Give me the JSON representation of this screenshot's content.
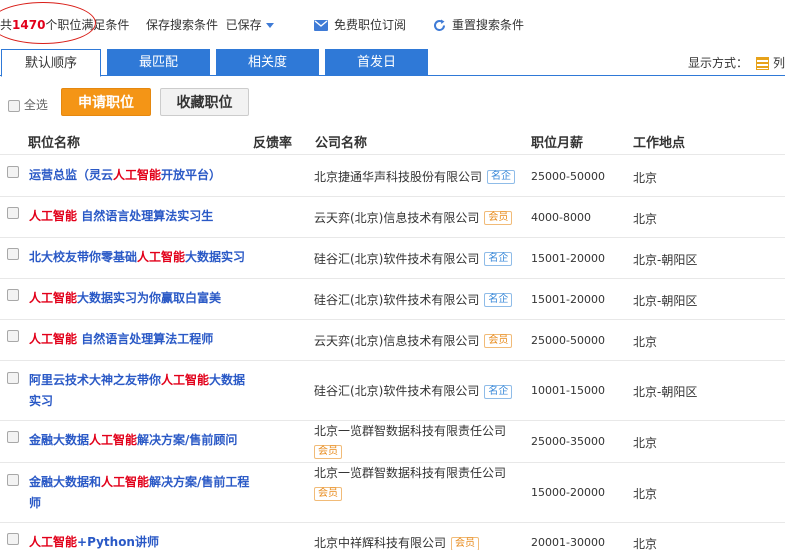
{
  "header": {
    "count_prefix": "共",
    "count": "1470",
    "count_suffix": "个职位满足条件",
    "save_search": "保存搜索条件",
    "saved": "已保存",
    "subscribe": "免费职位订阅",
    "reset": "重置搜索条件"
  },
  "tabs": [
    "默认顺序",
    "最匹配",
    "相关度",
    "首发日"
  ],
  "display_mode_label": "显示方式：",
  "display_mode_value": "列",
  "actions": {
    "select_all": "全选",
    "apply": "申请职位",
    "favorite": "收藏职位"
  },
  "columns": {
    "title": "职位名称",
    "feedback": "反馈率",
    "company": "公司名称",
    "salary": "职位月薪",
    "location": "工作地点"
  },
  "jobs": [
    {
      "p1": "运营总监（灵云",
      "kw": "人工智能",
      "p2": "开放平台）",
      "company": "北京捷通华声科技股份有限公司",
      "badge": "名企",
      "salary": "25000-50000",
      "location": "北京"
    },
    {
      "p1": "",
      "kw": "人工智能",
      "p2": " 自然语言处理算法实习生",
      "company": "云天弈(北京)信息技术有限公司",
      "badge": "会员",
      "salary": "4000-8000",
      "location": "北京"
    },
    {
      "p1": "北大校友带你零基础",
      "kw": "人工智能",
      "p2": "大数据实习",
      "company": "硅谷汇(北京)软件技术有限公司",
      "badge": "名企",
      "salary": "15001-20000",
      "location": "北京-朝阳区"
    },
    {
      "p1": "",
      "kw": "人工智能",
      "p2": "大数据实习为你赢取白富美",
      "company": "硅谷汇(北京)软件技术有限公司",
      "badge": "名企",
      "salary": "15001-20000",
      "location": "北京-朝阳区"
    },
    {
      "p1": "",
      "kw": "人工智能",
      "p2": " 自然语言处理算法工程师",
      "company": "云天弈(北京)信息技术有限公司",
      "badge": "会员",
      "salary": "25000-50000",
      "location": "北京"
    },
    {
      "p1": "阿里云技术大神之友带你",
      "kw": "人工智能",
      "p2": "大数据实习",
      "company": "硅谷汇(北京)软件技术有限公司",
      "badge": "名企",
      "salary": "10001-15000",
      "location": "北京-朝阳区"
    },
    {
      "p1": "金融大数据",
      "kw": "人工智能",
      "p2": "解决方案/售前顾问",
      "company": "北京一览群智数据科技有限责任公司",
      "badge": "会员",
      "salary": "25000-35000",
      "location": "北京"
    },
    {
      "p1": "金融大数据和",
      "kw": "人工智能",
      "p2": "解决方案/售前工程师",
      "company": "北京一览群智数据科技有限责任公司",
      "badge": "会员",
      "salary": "15000-20000",
      "location": "北京"
    },
    {
      "p1": "",
      "kw": "人工智能",
      "p2": "+Python讲师",
      "company": "北京中祥辉科技有限公司",
      "badge": "会员",
      "salary": "20001-30000",
      "location": "北京"
    }
  ]
}
